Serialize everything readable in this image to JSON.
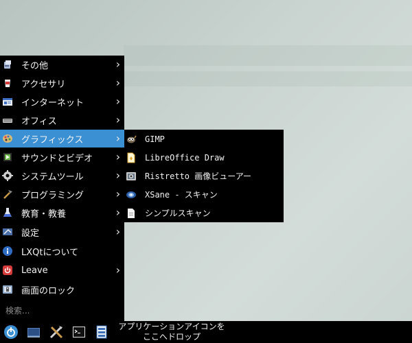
{
  "menu": {
    "items": [
      {
        "label": "その他",
        "icon": "other-icon",
        "has_submenu": true
      },
      {
        "label": "アクセサリ",
        "icon": "accessories-icon",
        "has_submenu": true
      },
      {
        "label": "インターネット",
        "icon": "internet-icon",
        "has_submenu": true
      },
      {
        "label": "オフィス",
        "icon": "office-icon",
        "has_submenu": true
      },
      {
        "label": "グラフィックス",
        "icon": "graphics-icon",
        "has_submenu": true,
        "active": true
      },
      {
        "label": "サウンドとビデオ",
        "icon": "sound-video-icon",
        "has_submenu": true
      },
      {
        "label": "システムツール",
        "icon": "system-tools-icon",
        "has_submenu": true
      },
      {
        "label": "プログラミング",
        "icon": "programming-icon",
        "has_submenu": true
      },
      {
        "label": "教育・教養",
        "icon": "education-icon",
        "has_submenu": true
      },
      {
        "label": "設定",
        "icon": "settings-icon",
        "has_submenu": true
      },
      {
        "label": "LXQtについて",
        "icon": "info-icon",
        "has_submenu": false
      },
      {
        "label": "Leave",
        "icon": "power-icon",
        "has_submenu": true
      },
      {
        "label": "画面のロック",
        "icon": "lock-screen-icon",
        "has_submenu": false
      }
    ],
    "search_placeholder": "検索..."
  },
  "submenu": {
    "items": [
      {
        "label": "GIMP",
        "icon": "gimp-icon"
      },
      {
        "label": "LibreOffice Draw",
        "icon": "libreoffice-draw-icon"
      },
      {
        "label": "Ristretto 画像ビューアー",
        "icon": "ristretto-icon"
      },
      {
        "label": "XSane - スキャン",
        "icon": "xsane-icon"
      },
      {
        "label": "シンプルスキャン",
        "icon": "simple-scan-icon"
      }
    ]
  },
  "taskbar": {
    "buttons": [
      "main-menu-icon",
      "show-desktop-icon",
      "tools-icon",
      "terminal-icon",
      "file-manager-icon"
    ],
    "drop_hint_line1": "アプリケーションアイコンを",
    "drop_hint_line2": "ここへドロップ"
  },
  "colors": {
    "menu_bg": "#000000",
    "highlight": "#3b90d4",
    "text": "#f2f2f2"
  }
}
